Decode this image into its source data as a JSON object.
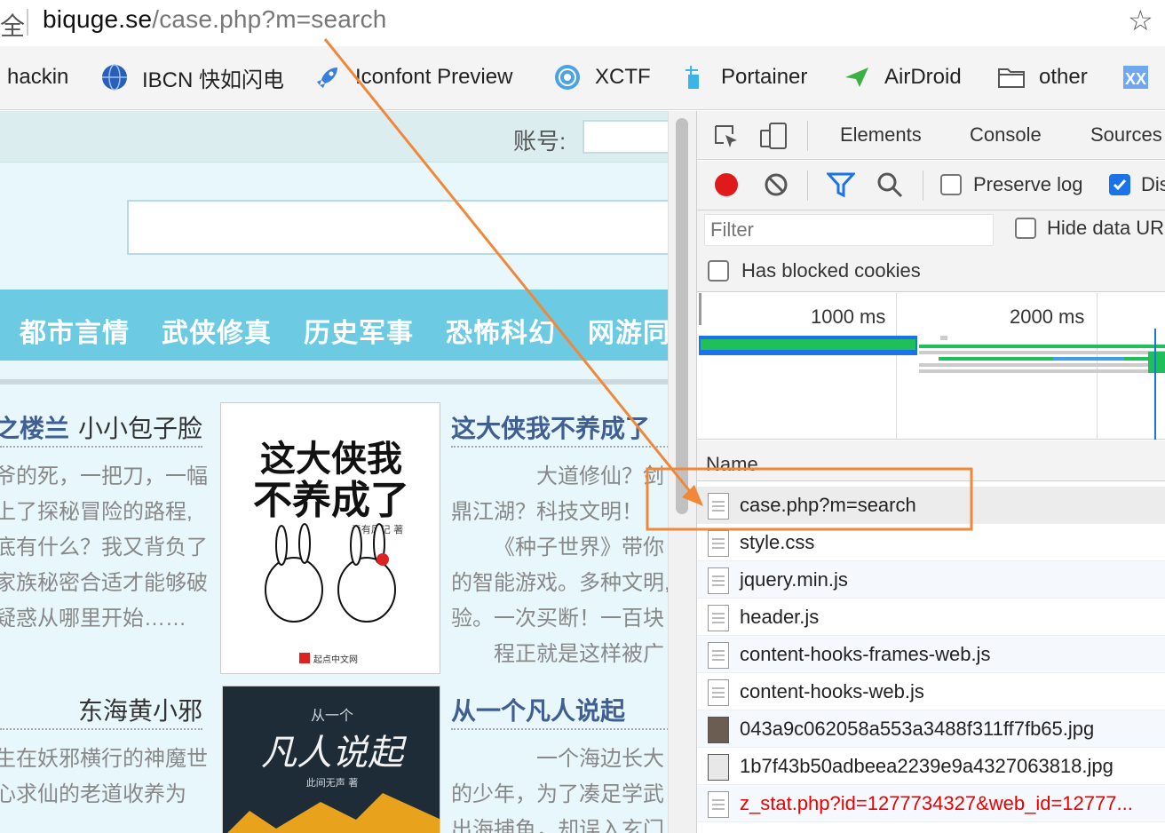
{
  "browser": {
    "secure_glyph": "全",
    "url_host": "biquge.se",
    "url_path": "/case.php?m=search",
    "bookmark_star": "☆"
  },
  "bookmarks": [
    {
      "label": "hackin",
      "icon": "none"
    },
    {
      "label": "IBCN 快如闪电",
      "icon": "globe-icon"
    },
    {
      "label": "Iconfont Preview",
      "icon": "rocket-icon"
    },
    {
      "label": "XCTF",
      "icon": "xctf-icon"
    },
    {
      "label": "Portainer",
      "icon": "portainer-icon"
    },
    {
      "label": "AirDroid",
      "icon": "airdroid-icon"
    },
    {
      "label": "other",
      "icon": "folder-icon"
    },
    {
      "label": "XX",
      "icon": "xx-icon"
    }
  ],
  "site": {
    "account_label": "账号:",
    "nav": [
      "都市言情",
      "武侠修真",
      "历史军事",
      "恐怖科幻",
      "网游同"
    ],
    "books": [
      {
        "title": "之楼兰",
        "author": "小小包子脸",
        "desc": [
          "爷的死，一把刀，一幅",
          "上了探秘冒险的路程,",
          "底有什么？我又背负了",
          "家族秘密合适才能够破",
          "疑惑从哪里开始……"
        ]
      },
      {
        "title": "这大侠我不养成了",
        "author": "",
        "desc": [
          "大道修仙？剑",
          "鼎江湖？科技文明！",
          "《种子世界》带你",
          "的智能游戏。多种文明,",
          "验。一次买断！一百块",
          "程正就是这样被广"
        ]
      },
      {
        "title": "",
        "author": "东海黄小邪",
        "desc": [
          "生在妖邪横行的神魔世",
          "心求仙的老道收养为"
        ]
      },
      {
        "title": "从一个凡人说起",
        "author": "",
        "desc": [
          "一个海边长大",
          "的少年，为了凑足学武",
          "出海捕鱼，却误入玄门"
        ]
      }
    ],
    "cover1": {
      "line1": "这大侠我",
      "line2": "不养成了",
      "author": "素有风记 著",
      "publisher": "起点中文网"
    },
    "cover2": {
      "line1": "从一个",
      "line2": "凡人说起",
      "author": "此间无声 著"
    }
  },
  "devtools": {
    "tabs": [
      "Elements",
      "Console",
      "Sources"
    ],
    "toolbar": {
      "preserve_log": "Preserve log",
      "disable_cache": "Dis",
      "preserve_checked": false,
      "disable_checked": true
    },
    "filter": {
      "placeholder": "Filter",
      "hide_data_urls": "Hide data UR",
      "has_blocked_cookies": "Has blocked cookies"
    },
    "timeline": {
      "labels": [
        "1000 ms",
        "2000 ms"
      ]
    },
    "column_name": "Name",
    "requests": [
      {
        "name": "case.php?m=search",
        "type": "doc",
        "error": false,
        "selected": true
      },
      {
        "name": "style.css",
        "type": "doc",
        "error": false,
        "selected": false
      },
      {
        "name": "jquery.min.js",
        "type": "doc",
        "error": false,
        "selected": false
      },
      {
        "name": "header.js",
        "type": "doc",
        "error": false,
        "selected": false
      },
      {
        "name": "content-hooks-frames-web.js",
        "type": "doc",
        "error": false,
        "selected": false
      },
      {
        "name": "content-hooks-web.js",
        "type": "doc",
        "error": false,
        "selected": false
      },
      {
        "name": "043a9c062058a553a3488f311ff7fb65.jpg",
        "type": "img",
        "error": false,
        "selected": false
      },
      {
        "name": "1b7f43b50adbeea2239e9a4327063818.jpg",
        "type": "img",
        "error": false,
        "selected": false
      },
      {
        "name": "z_stat.php?id=1277734327&web_id=12777...",
        "type": "doc",
        "error": true,
        "selected": false
      }
    ]
  },
  "colors": {
    "annotation": "#f0883a",
    "nav_bg": "#6ccbe3",
    "title_blue": "#3f5f93",
    "error_red": "#e00000"
  }
}
